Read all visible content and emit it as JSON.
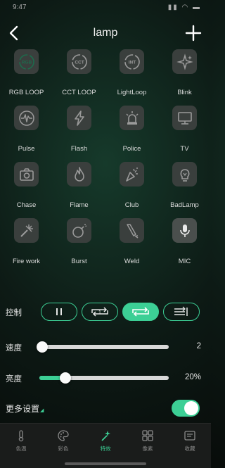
{
  "status_bar": {
    "time": "9:47",
    "icons": "▮▮ ◠ ▬"
  },
  "header": {
    "title": "lamp"
  },
  "effects": [
    {
      "label": "RGB LOOP",
      "icon": "rgb-loop-icon",
      "glyph": "RGB",
      "active": true
    },
    {
      "label": "CCT LOOP",
      "icon": "cct-loop-icon",
      "glyph": "CCT",
      "active": false
    },
    {
      "label": "LightLoop",
      "icon": "int-loop-icon",
      "glyph": "INT",
      "active": false
    },
    {
      "label": "Blink",
      "icon": "blink-stars-icon",
      "glyph": "",
      "active": false
    },
    {
      "label": "Pulse",
      "icon": "pulse-icon",
      "glyph": "",
      "active": false
    },
    {
      "label": "Flash",
      "icon": "lightning-icon",
      "glyph": "",
      "active": false
    },
    {
      "label": "Police",
      "icon": "police-siren-icon",
      "glyph": "",
      "active": false
    },
    {
      "label": "TV",
      "icon": "tv-monitor-icon",
      "glyph": "",
      "active": false
    },
    {
      "label": "Chase",
      "icon": "camera-icon",
      "glyph": "",
      "active": false
    },
    {
      "label": "Flame",
      "icon": "flame-icon",
      "glyph": "",
      "active": false
    },
    {
      "label": "Club",
      "icon": "party-popper-icon",
      "glyph": "",
      "active": false
    },
    {
      "label": "BadLamp",
      "icon": "bulb-icon",
      "glyph": "",
      "active": false
    },
    {
      "label": "Fire work",
      "icon": "firework-icon",
      "glyph": "",
      "active": false
    },
    {
      "label": "Burst",
      "icon": "bomb-icon",
      "glyph": "",
      "active": false
    },
    {
      "label": "Weld",
      "icon": "welding-torch-icon",
      "glyph": "",
      "active": false
    },
    {
      "label": "MIC",
      "icon": "microphone-icon",
      "glyph": "",
      "active": true
    }
  ],
  "control": {
    "label": "控制",
    "buttons": [
      {
        "name": "pause",
        "icon": "pause-icon",
        "active": false
      },
      {
        "name": "loop-once",
        "icon": "repeat-one-icon",
        "badge": "1",
        "active": false
      },
      {
        "name": "loop",
        "icon": "repeat-icon",
        "active": true
      },
      {
        "name": "list",
        "icon": "playlist-icon",
        "active": false
      }
    ]
  },
  "speed": {
    "label": "速度",
    "value": "2",
    "level": 0.0
  },
  "brightness": {
    "label": "亮度",
    "value": "20%",
    "level": 0.2
  },
  "more_settings": {
    "label": "更多设置",
    "enabled": true
  },
  "tabs": [
    {
      "label": "色温",
      "icon": "thermometer-icon",
      "active": false
    },
    {
      "label": "彩色",
      "icon": "palette-icon",
      "active": false
    },
    {
      "label": "特效",
      "icon": "magic-wand-icon",
      "active": true
    },
    {
      "label": "像素",
      "icon": "pixel-grid-icon",
      "active": false
    },
    {
      "label": "收藏",
      "icon": "favorites-icon",
      "active": false
    }
  ],
  "colors": {
    "accent": "#3ccf95",
    "tile": "#3a3f3d",
    "background": "#0d1a15"
  }
}
